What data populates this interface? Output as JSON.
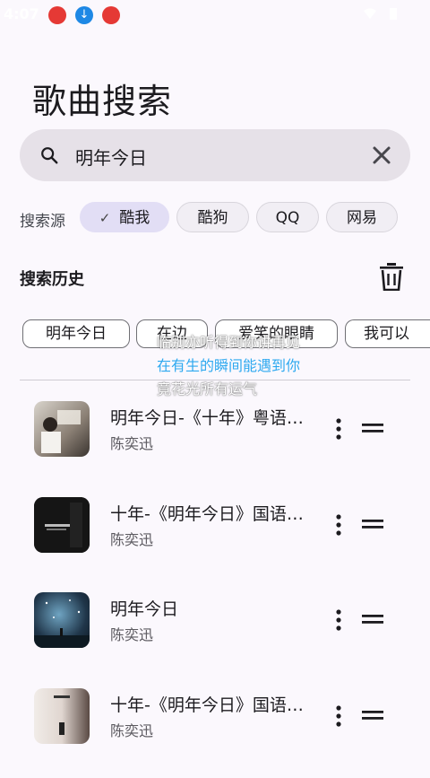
{
  "status_bar": {
    "time": "4:07"
  },
  "page": {
    "title": "歌曲搜索"
  },
  "search": {
    "value": "明年今日"
  },
  "sources": {
    "label": "搜索源",
    "items": [
      {
        "label": "酷我",
        "selected": true
      },
      {
        "label": "酷狗",
        "selected": false
      },
      {
        "label": "QQ",
        "selected": false
      },
      {
        "label": "网易",
        "selected": false
      }
    ]
  },
  "history": {
    "title": "搜索历史",
    "items": [
      "明年今日",
      "在边",
      "爱笑的眼睛",
      "我可以"
    ]
  },
  "lyrics": {
    "line1": "临别亦听得到你讲再见",
    "line2": "在有生的瞬间能遇到你",
    "line3": "竟花光所有运气"
  },
  "songs": [
    {
      "title": "明年今日-《十年》粤语…",
      "artist": "陈奕迅"
    },
    {
      "title": "十年-《明年今日》国语…",
      "artist": "陈奕迅"
    },
    {
      "title": "明年今日",
      "artist": "陈奕迅"
    },
    {
      "title": "十年-《明年今日》国语…",
      "artist": "陈奕迅"
    }
  ]
}
